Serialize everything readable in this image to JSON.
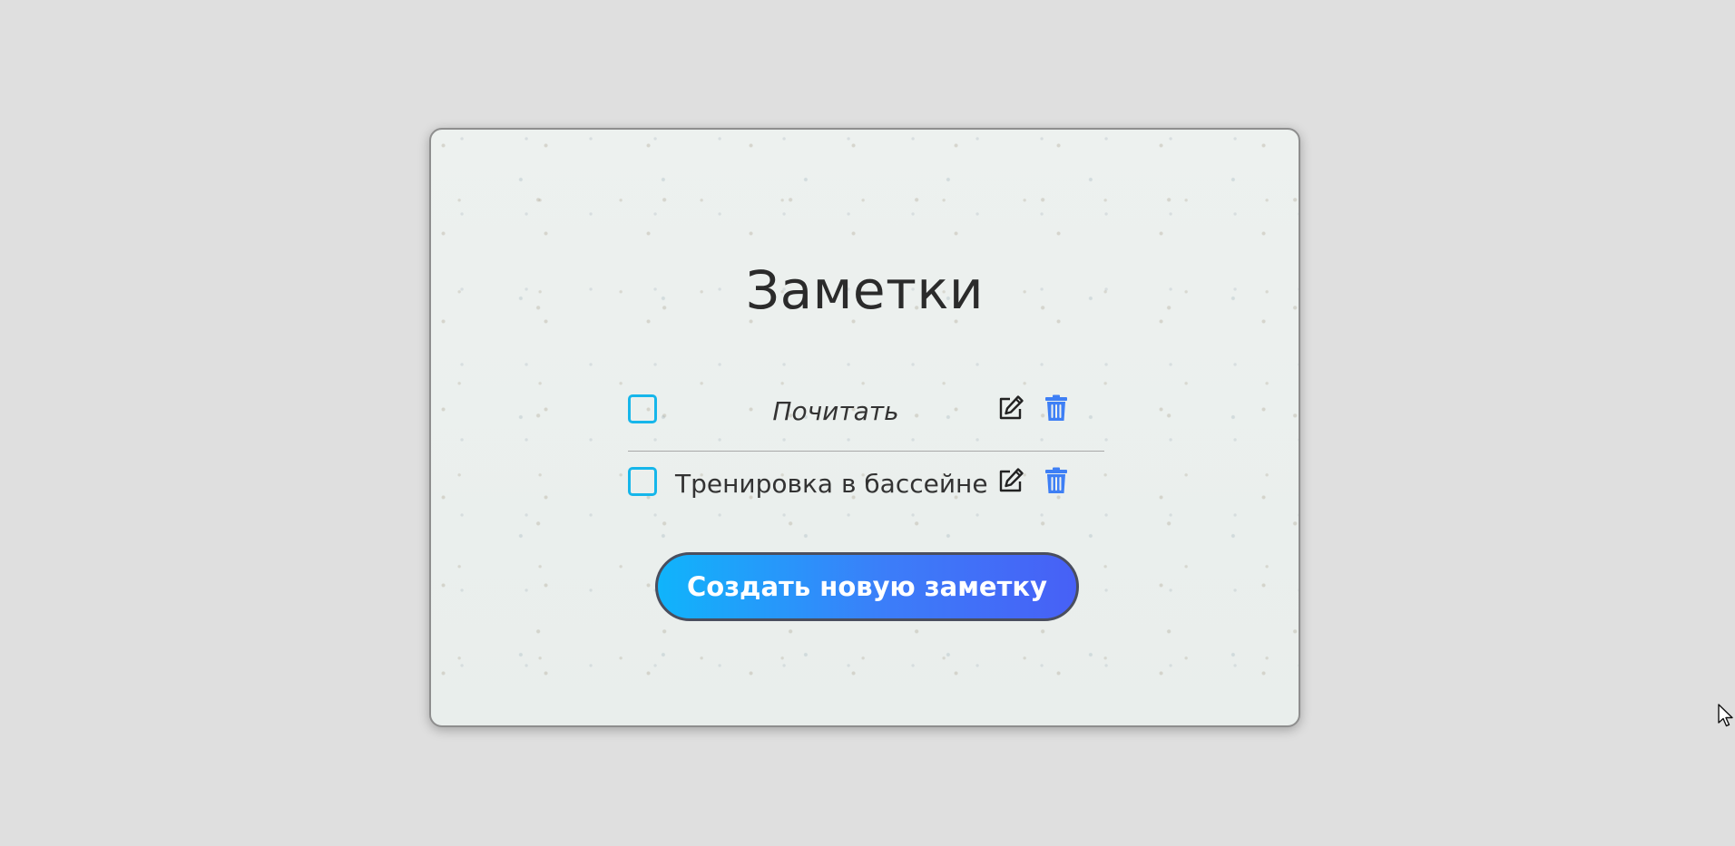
{
  "app": {
    "title": "Заметки"
  },
  "notes": [
    {
      "text": "Почитать",
      "checked": false,
      "style": "italic"
    },
    {
      "text": "Тренировка в бассейне",
      "checked": false,
      "style": "normal"
    }
  ],
  "icons": {
    "edit": "edit-icon",
    "delete": "trash-icon",
    "checkbox": "checkbox-icon"
  },
  "actions": {
    "create_label": "Создать новую заметку"
  },
  "colors": {
    "background": "#dfdfdf",
    "card_background": "#eef1ef",
    "checkbox_border": "#16b6ea",
    "trash_icon": "#3e7ff5",
    "button_gradient_start": "#10b4fb",
    "button_gradient_end": "#4760f6",
    "text": "#2b2b2b"
  }
}
